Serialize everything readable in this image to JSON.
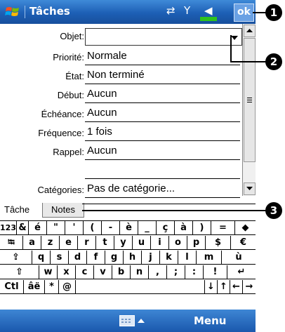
{
  "titlebar": {
    "app_title": "Tâches",
    "ok_label": "ok"
  },
  "form": {
    "subject": {
      "label": "Objet:",
      "value": ""
    },
    "priority": {
      "label": "Priorité:",
      "value": "Normale"
    },
    "status": {
      "label": "État:",
      "value": "Non terminé"
    },
    "start": {
      "label": "Début:",
      "value": "Aucun"
    },
    "due": {
      "label": "Échéance:",
      "value": "Aucun"
    },
    "frequency": {
      "label": "Fréquence:",
      "value": "1 fois"
    },
    "reminder": {
      "label": "Rappel:",
      "value": "Aucun"
    },
    "categories": {
      "label": "Catégories:",
      "value": "Pas de catégorie..."
    }
  },
  "tabs": [
    {
      "label": "Tâche"
    },
    {
      "label": "Notes"
    }
  ],
  "keyboard": {
    "rows": [
      [
        "123",
        "&",
        "é",
        "\"",
        "'",
        "(",
        "-",
        "è",
        "_",
        "ç",
        "à",
        ")",
        "=",
        "◆"
      ],
      [
        "⭾",
        "a",
        "z",
        "e",
        "r",
        "t",
        "y",
        "u",
        "i",
        "o",
        "p",
        "$",
        "€"
      ],
      [
        "⇪",
        "q",
        "s",
        "d",
        "f",
        "g",
        "h",
        "j",
        "k",
        "l",
        "m",
        "ù"
      ],
      [
        "⇧",
        "w",
        "x",
        "c",
        "v",
        "b",
        "n",
        ",",
        ";",
        ":",
        "!",
        "↵"
      ],
      [
        "Ctl",
        "âë",
        "*",
        "@",
        " ",
        "↓",
        "↑",
        "←",
        "→"
      ]
    ]
  },
  "bottombar": {
    "menu_label": "Menu",
    "keyboard_icon": "keyboard-icon"
  },
  "callouts": [
    "1",
    "2",
    "3"
  ],
  "colors": {
    "titlebar": "#1d5fb5",
    "bottombar": "#1a58ad"
  }
}
